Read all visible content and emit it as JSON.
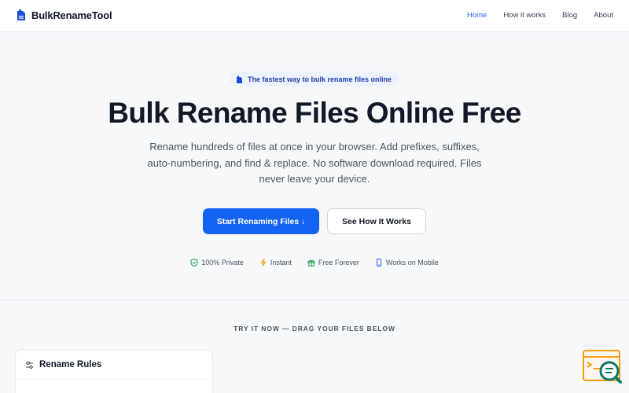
{
  "brand": {
    "name": "BulkRenameTool",
    "icon": "document-icon",
    "accent": "#1d4ed8"
  },
  "nav": {
    "links": [
      {
        "label": "Home",
        "active": true
      },
      {
        "label": "How it works",
        "active": false
      },
      {
        "label": "Blog",
        "active": false
      },
      {
        "label": "About",
        "active": false
      }
    ]
  },
  "hero": {
    "pill_text": "The fastest way to bulk rename files online",
    "headline": "Bulk Rename Files Online Free",
    "subtitle": "Rename hundreds of files at once in your browser. Add prefixes, suffixes, auto-numbering, and find & replace. No software download required. Files never leave your device.",
    "primary_button": "Start Renaming Files ↓",
    "secondary_button": "See How It Works",
    "features": [
      {
        "label": "100% Private",
        "icon": "shield-check-icon",
        "color": "#16a34a"
      },
      {
        "label": "Instant",
        "icon": "lightning-icon",
        "color": "#f59e0b"
      },
      {
        "label": "Free Forever",
        "icon": "gift-icon",
        "color": "#16a34a"
      },
      {
        "label": "Works on Mobile",
        "icon": "phone-icon",
        "color": "#2563eb"
      }
    ]
  },
  "try_section": {
    "label": "TRY IT NOW — DRAG YOUR FILES BELOW",
    "card_title": "Rename Rules"
  },
  "colors": {
    "primary": "#1363f5",
    "link_active": "#2563eb",
    "background": "#f7f8fa"
  }
}
